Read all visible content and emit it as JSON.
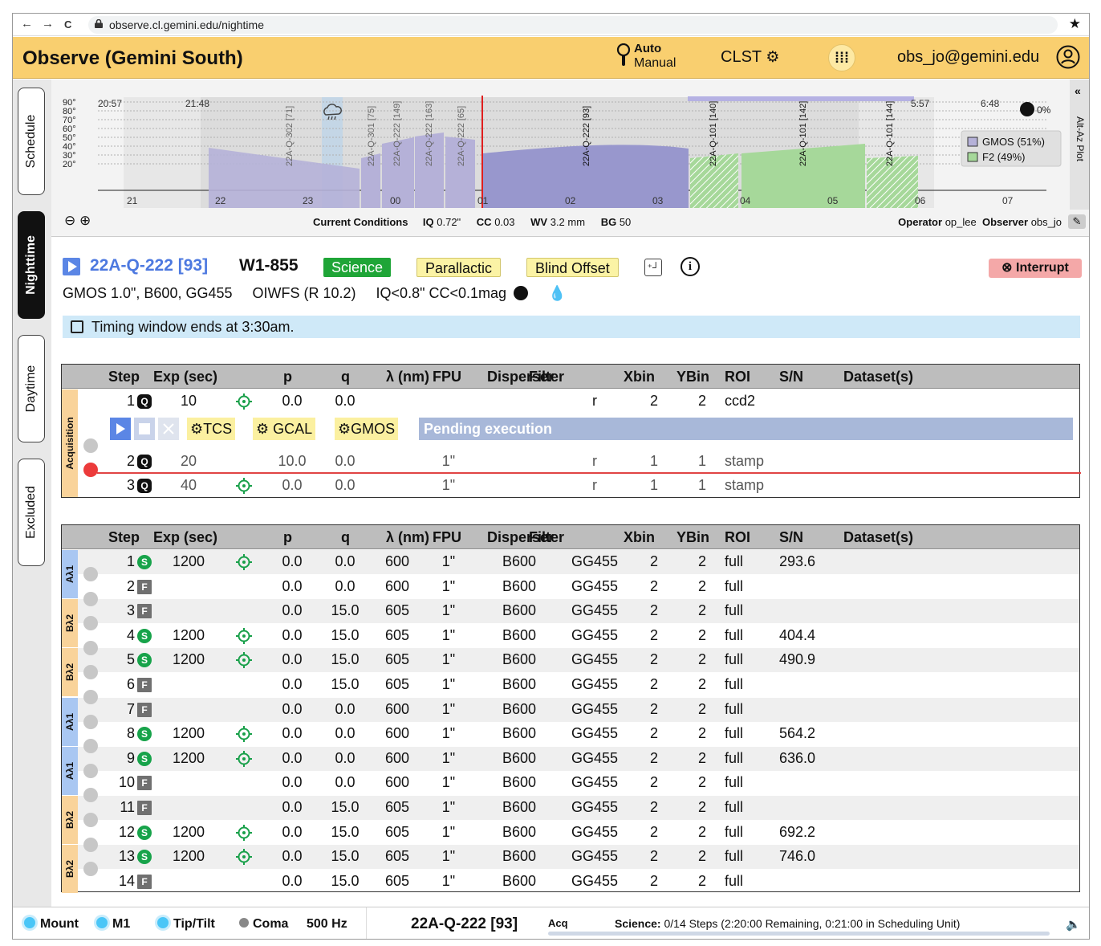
{
  "browser": {
    "url": "observe.cl.gemini.edu/nightime",
    "nav_back": "←",
    "nav_fwd": "→",
    "nav_reload": "C",
    "star": "★"
  },
  "header": {
    "title": "Observe (Gemini South)",
    "mode_auto": "Auto",
    "mode_manual": "Manual",
    "clst": "CLST",
    "user": "obs_jo@gemini.edu"
  },
  "sidetabs": [
    "Schedule",
    "Nighttime",
    "Daytime",
    "Excluded"
  ],
  "plot": {
    "yticks": [
      "90°",
      "80°",
      "70°",
      "60°",
      "50°",
      "40°",
      "30°",
      "20°"
    ],
    "times": [
      "20:57",
      "21:48",
      "5:57",
      "6:48"
    ],
    "hours": [
      "21",
      "22",
      "23",
      "00",
      "01",
      "02",
      "03",
      "04",
      "05",
      "06",
      "07"
    ],
    "bars": [
      "22A-Q-302 [71]",
      "22A-Q-301 [75]",
      "22A-Q-222 [149]",
      "22A-Q-222 [163]",
      "22A-Q-222 [65]",
      "22A-Q-222 [93]",
      "22A-Q-101 [140]",
      "22A-Q-101 [142]",
      "22A-Q-101 [144]"
    ],
    "moon": "0%",
    "legend": [
      {
        "label": "GMOS (51%)",
        "color": "#b5b1d8"
      },
      {
        "label": "F2 (49%)",
        "color": "#a6d89a"
      }
    ],
    "toggle_label": "Alt-Az Plot",
    "toggle_chev": "«"
  },
  "conditions": {
    "label": "Current Conditions",
    "iq_label": "IQ",
    "iq": "0.72\"",
    "cc_label": "CC",
    "cc": "0.03",
    "wv_label": "WV",
    "wv": "3.2 mm",
    "bg_label": "BG",
    "bg": "50",
    "operator_label": "Operator",
    "operator": "op_lee",
    "observer_label": "Observer",
    "observer": "obs_jo"
  },
  "observation": {
    "id": "22A-Q-222 [93]",
    "name": "W1-855",
    "tags": [
      "Science",
      "Parallactic",
      "Blind Offset"
    ],
    "interrupt": "Interrupt",
    "config": "GMOS 1.0\", B600, GG455",
    "wfs": "OIWFS (R 10.2)",
    "constraints": "IQ<0.8\" CC<0.1mag",
    "timing": "Timing window ends at 3:30am."
  },
  "columns": [
    "Step",
    "Exp (sec)",
    "p",
    "q",
    "λ (nm)",
    "FPU",
    "Disperser",
    "Filter",
    "Xbin",
    "YBin",
    "ROI",
    "S/N",
    "Dataset(s)"
  ],
  "acquisition": {
    "group_label": "Acquisition",
    "controls": [
      "TCS",
      "GCAL",
      "GMOS"
    ],
    "pending": "Pending execution",
    "rows": [
      {
        "step": "1",
        "type": "Q",
        "exp": "10",
        "target": true,
        "p": "0.0",
        "q": "0.0",
        "lambda": "",
        "fpu": "",
        "disperser": "",
        "filter": "r",
        "xbin": "2",
        "ybin": "2",
        "roi": "ccd2",
        "sn": ""
      },
      {
        "step": "2",
        "type": "Q",
        "exp": "20",
        "target": false,
        "p": "10.0",
        "q": "0.0",
        "lambda": "",
        "fpu": "1\"",
        "disperser": "",
        "filter": "r",
        "xbin": "1",
        "ybin": "1",
        "roi": "stamp",
        "sn": ""
      },
      {
        "step": "3",
        "type": "Q",
        "exp": "40",
        "target": true,
        "p": "0.0",
        "q": "0.0",
        "lambda": "",
        "fpu": "1\"",
        "disperser": "",
        "filter": "r",
        "xbin": "1",
        "ybin": "1",
        "roi": "stamp",
        "sn": ""
      }
    ]
  },
  "science": {
    "groups": [
      {
        "label": "Aλ1",
        "color": "blue"
      },
      {
        "label": "Bλ2",
        "color": "orange"
      },
      {
        "label": "Bλ2",
        "color": "orange"
      },
      {
        "label": "Aλ1",
        "color": "blue"
      },
      {
        "label": "Aλ1",
        "color": "blue"
      },
      {
        "label": "Bλ2",
        "color": "orange"
      },
      {
        "label": "Bλ2",
        "color": "orange"
      }
    ],
    "rows": [
      {
        "step": "1",
        "type": "S",
        "exp": "1200",
        "target": true,
        "p": "0.0",
        "q": "0.0",
        "lambda": "600",
        "fpu": "1\"",
        "disperser": "B600",
        "filter": "GG455",
        "xbin": "2",
        "ybin": "2",
        "roi": "full",
        "sn": "293.6"
      },
      {
        "step": "2",
        "type": "F",
        "exp": "",
        "target": false,
        "p": "0.0",
        "q": "0.0",
        "lambda": "600",
        "fpu": "1\"",
        "disperser": "B600",
        "filter": "GG455",
        "xbin": "2",
        "ybin": "2",
        "roi": "full",
        "sn": ""
      },
      {
        "step": "3",
        "type": "F",
        "exp": "",
        "target": false,
        "p": "0.0",
        "q": "15.0",
        "lambda": "605",
        "fpu": "1\"",
        "disperser": "B600",
        "filter": "GG455",
        "xbin": "2",
        "ybin": "2",
        "roi": "full",
        "sn": ""
      },
      {
        "step": "4",
        "type": "S",
        "exp": "1200",
        "target": true,
        "p": "0.0",
        "q": "15.0",
        "lambda": "605",
        "fpu": "1\"",
        "disperser": "B600",
        "filter": "GG455",
        "xbin": "2",
        "ybin": "2",
        "roi": "full",
        "sn": "404.4"
      },
      {
        "step": "5",
        "type": "S",
        "exp": "1200",
        "target": true,
        "p": "0.0",
        "q": "15.0",
        "lambda": "605",
        "fpu": "1\"",
        "disperser": "B600",
        "filter": "GG455",
        "xbin": "2",
        "ybin": "2",
        "roi": "full",
        "sn": "490.9"
      },
      {
        "step": "6",
        "type": "F",
        "exp": "",
        "target": false,
        "p": "0.0",
        "q": "15.0",
        "lambda": "605",
        "fpu": "1\"",
        "disperser": "B600",
        "filter": "GG455",
        "xbin": "2",
        "ybin": "2",
        "roi": "full",
        "sn": ""
      },
      {
        "step": "7",
        "type": "F",
        "exp": "",
        "target": false,
        "p": "0.0",
        "q": "0.0",
        "lambda": "600",
        "fpu": "1\"",
        "disperser": "B600",
        "filter": "GG455",
        "xbin": "2",
        "ybin": "2",
        "roi": "full",
        "sn": ""
      },
      {
        "step": "8",
        "type": "S",
        "exp": "1200",
        "target": true,
        "p": "0.0",
        "q": "0.0",
        "lambda": "600",
        "fpu": "1\"",
        "disperser": "B600",
        "filter": "GG455",
        "xbin": "2",
        "ybin": "2",
        "roi": "full",
        "sn": "564.2"
      },
      {
        "step": "9",
        "type": "S",
        "exp": "1200",
        "target": true,
        "p": "0.0",
        "q": "0.0",
        "lambda": "600",
        "fpu": "1\"",
        "disperser": "B600",
        "filter": "GG455",
        "xbin": "2",
        "ybin": "2",
        "roi": "full",
        "sn": "636.0"
      },
      {
        "step": "10",
        "type": "F",
        "exp": "",
        "target": false,
        "p": "0.0",
        "q": "0.0",
        "lambda": "600",
        "fpu": "1\"",
        "disperser": "B600",
        "filter": "GG455",
        "xbin": "2",
        "ybin": "2",
        "roi": "full",
        "sn": ""
      },
      {
        "step": "11",
        "type": "F",
        "exp": "",
        "target": false,
        "p": "0.0",
        "q": "15.0",
        "lambda": "605",
        "fpu": "1\"",
        "disperser": "B600",
        "filter": "GG455",
        "xbin": "2",
        "ybin": "2",
        "roi": "full",
        "sn": ""
      },
      {
        "step": "12",
        "type": "S",
        "exp": "1200",
        "target": true,
        "p": "0.0",
        "q": "15.0",
        "lambda": "605",
        "fpu": "1\"",
        "disperser": "B600",
        "filter": "GG455",
        "xbin": "2",
        "ybin": "2",
        "roi": "full",
        "sn": "692.2"
      },
      {
        "step": "13",
        "type": "S",
        "exp": "1200",
        "target": true,
        "p": "0.0",
        "q": "15.0",
        "lambda": "605",
        "fpu": "1\"",
        "disperser": "B600",
        "filter": "GG455",
        "xbin": "2",
        "ybin": "2",
        "roi": "full",
        "sn": "746.0"
      },
      {
        "step": "14",
        "type": "F",
        "exp": "",
        "target": false,
        "p": "0.0",
        "q": "15.0",
        "lambda": "605",
        "fpu": "1\"",
        "disperser": "B600",
        "filter": "GG455",
        "xbin": "2",
        "ybin": "2",
        "roi": "full",
        "sn": ""
      }
    ]
  },
  "footer": {
    "mount": "Mount",
    "m1": "M1",
    "tiptilt": "Tip/Tilt",
    "coma": "Coma",
    "hz": "500 Hz",
    "obs": "22A-Q-222 [93]",
    "acq": "Acq",
    "science_label": "Science:",
    "science_text": "0/14 Steps (2:20:00 Remaining, 0:21:00 in Scheduling Unit)"
  }
}
